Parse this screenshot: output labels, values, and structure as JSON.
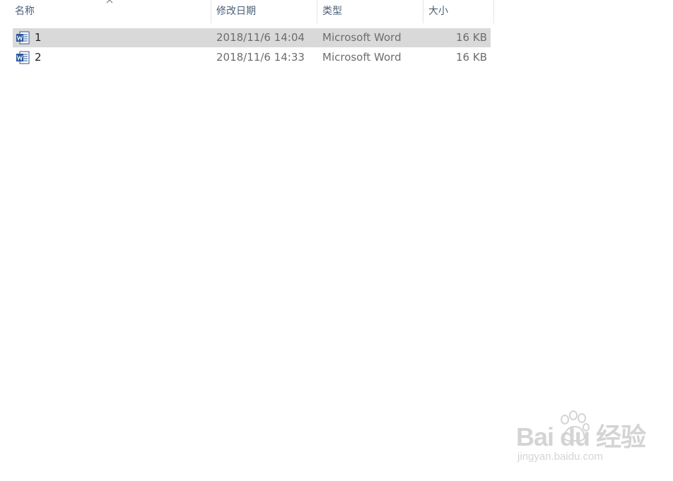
{
  "columns": {
    "name": "名称",
    "date": "修改日期",
    "type": "类型",
    "size": "大小"
  },
  "files": [
    {
      "name": "1",
      "date": "2018/11/6 14:04",
      "type": "Microsoft Word",
      "size": "16 KB",
      "selected": true
    },
    {
      "name": "2",
      "date": "2018/11/6 14:33",
      "type": "Microsoft Word",
      "size": "16 KB",
      "selected": false
    }
  ],
  "watermark": {
    "main": "Bai  du 经验",
    "sub": "jingyan.baidu.com"
  },
  "colors": {
    "header_text": "#4c607a",
    "selection": "#d9d9d9",
    "word_blue": "#2b579a"
  },
  "icons": [
    "sort-up-icon",
    "word-document-icon"
  ]
}
